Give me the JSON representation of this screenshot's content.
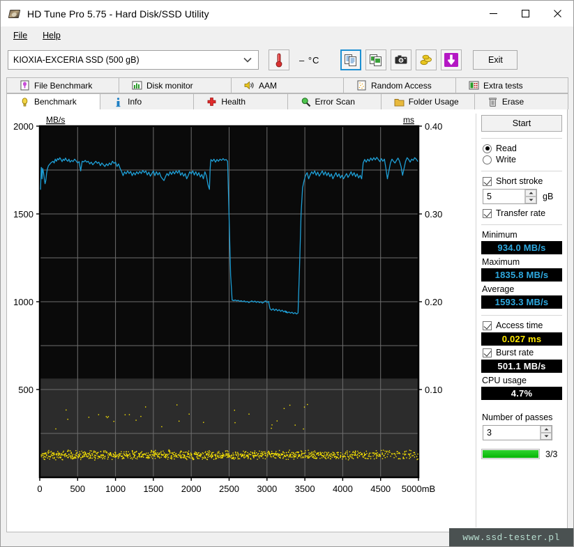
{
  "window": {
    "title": "HD Tune Pro 5.75 - Hard Disk/SSD Utility",
    "icon": "hdd-icon",
    "minimize_label": "—",
    "maximize_label": "□",
    "close_label": "✕"
  },
  "menu": {
    "items": [
      "File",
      "Help"
    ]
  },
  "toolbar": {
    "drive": "KIOXIA-EXCERIA SSD (500 gB)",
    "temperature": "– °C",
    "exit_label": "Exit",
    "buttons": [
      {
        "name": "copy-text-button",
        "selected": true
      },
      {
        "name": "copy-image-button",
        "selected": false
      },
      {
        "name": "screenshot-button",
        "selected": false
      },
      {
        "name": "donate-button",
        "selected": false
      },
      {
        "name": "download-button",
        "selected": false
      }
    ]
  },
  "tabs": {
    "top_row": [
      {
        "label": "File Benchmark",
        "icon": "file-benchmark-icon"
      },
      {
        "label": "Disk monitor",
        "icon": "disk-monitor-icon"
      },
      {
        "label": "AAM",
        "icon": "speaker-icon"
      },
      {
        "label": "Random Access",
        "icon": "random-access-icon"
      },
      {
        "label": "Extra tests",
        "icon": "extra-tests-icon"
      }
    ],
    "bottom_row": [
      {
        "label": "Benchmark",
        "icon": "lightbulb-icon",
        "active": true
      },
      {
        "label": "Info",
        "icon": "info-icon",
        "active": false
      },
      {
        "label": "Health",
        "icon": "health-cross-icon",
        "active": false
      },
      {
        "label": "Error Scan",
        "icon": "magnifier-icon",
        "active": false
      },
      {
        "label": "Folder Usage",
        "icon": "folder-icon",
        "active": false
      },
      {
        "label": "Erase",
        "icon": "trash-icon",
        "active": false
      }
    ]
  },
  "panel": {
    "start_label": "Start",
    "mode": {
      "read_label": "Read",
      "write_label": "Write",
      "selected": "Read"
    },
    "short_stroke": {
      "label": "Short stroke",
      "checked": true,
      "value": "5",
      "unit": "gB"
    },
    "transfer_rate": {
      "label": "Transfer rate",
      "checked": true
    },
    "minimum": {
      "label": "Minimum",
      "value": "934.0 MB/s"
    },
    "maximum": {
      "label": "Maximum",
      "value": "1835.8 MB/s"
    },
    "average": {
      "label": "Average",
      "value": "1593.3 MB/s"
    },
    "access_time": {
      "label": "Access time",
      "checked": true,
      "value": "0.027 ms"
    },
    "burst_rate": {
      "label": "Burst rate",
      "checked": true,
      "value": "501.1 MB/s"
    },
    "cpu_usage": {
      "label": "CPU usage",
      "value": "4.7%"
    },
    "passes": {
      "label": "Number of passes",
      "value": "3",
      "progress_text": "3/3",
      "progress_percent": 100
    }
  },
  "watermark": "www.ssd-tester.pl",
  "colors": {
    "transfer_line": "#1e9fd6",
    "access_dot": "#ffe800",
    "stat_cyan": "#2ea9e0",
    "stat_yellow": "#ffe800",
    "progress_green": "#06b506",
    "accent_blue": "#1e90d2"
  },
  "chart_data": {
    "type": "line",
    "title": "",
    "xlabel": "mB",
    "ylabel": "MB/s",
    "y2label": "ms",
    "xlim": [
      0,
      5000
    ],
    "ylim": [
      0,
      2000
    ],
    "y2lim": [
      0,
      0.4
    ],
    "grid": true,
    "legend_position": "none",
    "xticks": [
      0,
      500,
      1000,
      1500,
      2000,
      2500,
      3000,
      3500,
      4000,
      4500,
      5000
    ],
    "yticks": [
      500,
      1000,
      1500,
      2000
    ],
    "y2ticks": [
      0.1,
      0.2,
      0.3,
      0.4
    ],
    "series": [
      {
        "name": "Transfer rate",
        "axis": "left",
        "color": "#1e9fd6",
        "unit": "MB/s",
        "x": [
          10,
          20,
          25,
          30,
          40,
          50,
          60,
          70,
          80,
          90,
          100,
          115,
          130,
          145,
          160,
          175,
          190,
          205,
          220,
          235,
          250,
          265,
          280,
          295,
          310,
          325,
          340,
          355,
          370,
          385,
          400,
          420,
          440,
          460,
          480,
          500,
          520,
          540,
          560,
          580,
          600,
          620,
          640,
          660,
          680,
          700,
          720,
          740,
          760,
          780,
          800,
          820,
          840,
          860,
          880,
          900,
          920,
          940,
          960,
          980,
          1000,
          1020,
          1040,
          1060,
          1080,
          1100,
          1120,
          1140,
          1160,
          1180,
          1200,
          1220,
          1240,
          1260,
          1280,
          1300,
          1320,
          1340,
          1360,
          1380,
          1400,
          1420,
          1440,
          1460,
          1480,
          1500,
          1520,
          1540,
          1560,
          1580,
          1600,
          1620,
          1640,
          1660,
          1680,
          1700,
          1720,
          1740,
          1760,
          1780,
          1800,
          1820,
          1840,
          1860,
          1880,
          1900,
          1920,
          1940,
          1960,
          1980,
          2000,
          2020,
          2040,
          2060,
          2080,
          2100,
          2120,
          2140,
          2160,
          2180,
          2200,
          2220,
          2240,
          2245,
          2250,
          2255,
          2260,
          2280,
          2300,
          2320,
          2340,
          2360,
          2380,
          2400,
          2420,
          2440,
          2460,
          2480,
          2500,
          2520,
          2540,
          2560,
          2580,
          2600,
          2620,
          2640,
          2660,
          2680,
          2700,
          2720,
          2740,
          2760,
          2780,
          2800,
          2820,
          2840,
          2860,
          2880,
          2900,
          2920,
          2940,
          2960,
          2980,
          3000,
          3020,
          3040,
          3060,
          3080,
          3100,
          3120,
          3140,
          3160,
          3180,
          3200,
          3220,
          3240,
          3245,
          3250,
          3255,
          3260,
          3270,
          3290,
          3310,
          3330,
          3350,
          3370,
          3390,
          3410,
          3430,
          3450,
          3470,
          3490,
          3510,
          3530,
          3550,
          3570,
          3590,
          3610,
          3630,
          3650,
          3670,
          3690,
          3710,
          3730,
          3750,
          3770,
          3790,
          3810,
          3830,
          3850,
          3870,
          3890,
          3910,
          3930,
          3950,
          3970,
          3990,
          4010,
          4030,
          4050,
          4070,
          4090,
          4110,
          4130,
          4150,
          4170,
          4190,
          4210,
          4230,
          4250,
          4270,
          4290,
          4310,
          4330,
          4350,
          4370,
          4390,
          4410,
          4430,
          4450,
          4470,
          4490,
          4510,
          4530,
          4550,
          4570,
          4590,
          4610,
          4630,
          4650,
          4670,
          4690,
          4710,
          4730,
          4750,
          4770,
          4790,
          4810,
          4830,
          4850,
          4870,
          4890,
          4910,
          4930,
          4950,
          4970,
          4990
        ],
        "y": [
          1640,
          1765,
          1762,
          1700,
          1758,
          1735,
          1700,
          1672,
          1690,
          1730,
          1755,
          1775,
          1782,
          1790,
          1795,
          1800,
          1790,
          1812,
          1800,
          1815,
          1808,
          1820,
          1810,
          1798,
          1812,
          1804,
          1818,
          1806,
          1800,
          1812,
          1795,
          1805,
          1798,
          1812,
          1802,
          1790,
          1798,
          1745,
          1800,
          1796,
          1805,
          1795,
          1800,
          1785,
          1795,
          1780,
          1790,
          1800,
          1788,
          1795,
          1775,
          1790,
          1780,
          1770,
          1785,
          1775,
          1790,
          1780,
          1800,
          1788,
          1795,
          1770,
          1785,
          1760,
          1742,
          1718,
          1740,
          1728,
          1745,
          1730,
          1742,
          1718,
          1735,
          1722,
          1740,
          1728,
          1742,
          1730,
          1748,
          1735,
          1745,
          1722,
          1738,
          1715,
          1730,
          1745,
          1718,
          1740,
          1722,
          1736,
          1712,
          1700,
          1690,
          1712,
          1730,
          1718,
          1740,
          1725,
          1742,
          1728,
          1745,
          1732,
          1748,
          1720,
          1735,
          1715,
          1730,
          1700,
          1718,
          1740,
          1728,
          1745,
          1722,
          1740,
          1718,
          1735,
          1710,
          1725,
          1700,
          1740,
          1718,
          1668,
          1640,
          1700,
          1760,
          1790,
          1810,
          1800,
          1812,
          1795,
          1810,
          1800,
          1812,
          1805,
          1815,
          1806,
          1810,
          1800,
          1480,
          1150,
          1010,
          1006,
          1010,
          1005,
          1008,
          1002,
          1006,
          1000,
          1005,
          998,
          1002,
          995,
          1000,
          1005,
          998,
          1004,
          996,
          1002,
          995,
          1000,
          992,
          998,
          1005,
          996,
          1002,
          960,
          952,
          960,
          950,
          958,
          948,
          955,
          945,
          952,
          942,
          948,
          940,
          946,
          938,
          944,
          936,
          942,
          935,
          940,
          932,
          938,
          930,
          936,
          1200,
          1500,
          1650,
          1690,
          1720,
          1735,
          1700,
          1722,
          1740,
          1728,
          1745,
          1720,
          1738,
          1715,
          1730,
          1745,
          1722,
          1740,
          1718,
          1735,
          1712,
          1728,
          1700,
          1718,
          1735,
          1712,
          1728,
          1705,
          1720,
          1700,
          1715,
          1730,
          1708,
          1722,
          1740,
          1718,
          1735,
          1712,
          1728,
          1705,
          1720,
          1700,
          1790,
          1810,
          1795,
          1812,
          1800,
          1818,
          1805,
          1820,
          1808,
          1822,
          1810,
          1798,
          1815,
          1800,
          1812,
          1760,
          1700,
          1745,
          1790,
          1812,
          1800,
          1790,
          1805,
          1818,
          1800,
          1770,
          1720,
          1760,
          1800,
          1820,
          1810,
          1795,
          1812,
          1805,
          1820,
          1812,
          1800,
          1815,
          1805,
          1818,
          1810,
          1822,
          1812,
          1820,
          1815,
          1818,
          1820,
          1812
        ],
        "min": 934.0,
        "max": 1835.8,
        "avg": 1593.3
      },
      {
        "name": "Access time",
        "axis": "right",
        "color": "#ffe800",
        "unit": "ms",
        "type": "scatter",
        "mean": 0.027,
        "baseline_range": [
          0.02,
          0.032
        ],
        "outlier_range": [
          0.055,
          0.085
        ],
        "point_count": 1300,
        "outlier_fraction": 0.03
      }
    ]
  }
}
